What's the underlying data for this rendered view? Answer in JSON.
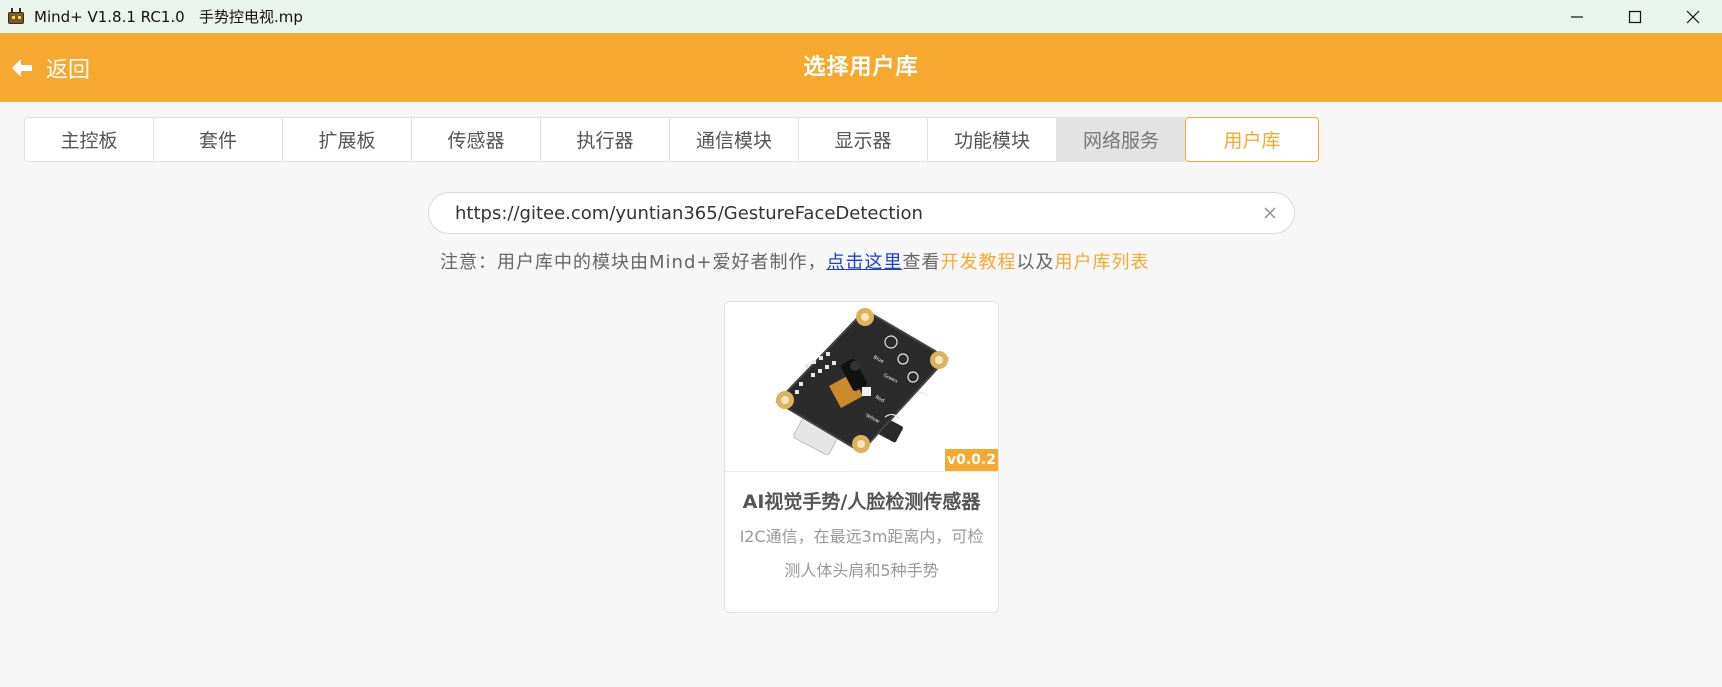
{
  "window": {
    "title": "Mind+ V1.8.1 RC1.0   手势控电视.mp",
    "icon": "mind-plus-robot-icon"
  },
  "header": {
    "back_label": "返回",
    "title": "选择用户库",
    "accent_color": "#f7a92f"
  },
  "tabs": [
    {
      "label": "主控板"
    },
    {
      "label": "套件"
    },
    {
      "label": "扩展板"
    },
    {
      "label": "传感器"
    },
    {
      "label": "执行器"
    },
    {
      "label": "通信模块"
    },
    {
      "label": "显示器"
    },
    {
      "label": "功能模块"
    },
    {
      "label": "网络服务"
    },
    {
      "label": "用户库",
      "selected": true
    }
  ],
  "search": {
    "value": "https://gitee.com/yuntian365/GestureFaceDetection"
  },
  "notice": {
    "prefix": "注意：用户库中的模块由Mind+爱好者制作，",
    "link": "点击这里",
    "middle": "查看",
    "dev_tutorial": "开发教程",
    "and": "以及",
    "library_list": "用户库列表"
  },
  "card": {
    "version": "v0.0.2",
    "title": "AI视觉手势/人脸检测传感器",
    "description": "I2C通信，在最远3m距离内，可检测人体头肩和5种手势",
    "image": "gesture-face-detection-sensor-board"
  }
}
